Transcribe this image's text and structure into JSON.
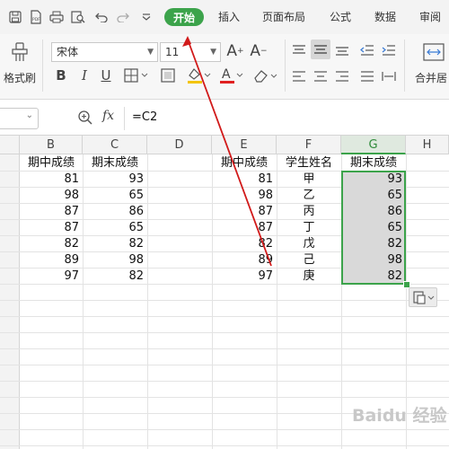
{
  "toolbar_tabs": {
    "home": "开始",
    "insert": "插入",
    "page_layout": "页面布局",
    "formulas": "公式",
    "data": "数据",
    "review": "审阅"
  },
  "ribbon": {
    "format_painter_label": "格式刷",
    "font_name": "宋体",
    "font_size": "11",
    "bold": "B",
    "italic": "I",
    "underline": "U",
    "grow_font": "A⁺",
    "shrink_font": "A⁻",
    "merge_label": "合并居"
  },
  "formula_bar": {
    "fx_label": "fx",
    "formula": "=C2"
  },
  "columns": [
    "B",
    "C",
    "D",
    "E",
    "F",
    "G",
    "H"
  ],
  "selected_column": "G",
  "left_table": {
    "headers": [
      "期中成绩",
      "期末成绩"
    ],
    "rows": [
      [
        "81",
        "93"
      ],
      [
        "98",
        "65"
      ],
      [
        "87",
        "86"
      ],
      [
        "87",
        "65"
      ],
      [
        "82",
        "82"
      ],
      [
        "89",
        "98"
      ],
      [
        "97",
        "82"
      ]
    ]
  },
  "right_table": {
    "headers": [
      "期中成绩",
      "学生姓名",
      "期末成绩"
    ],
    "rows": [
      [
        "81",
        "甲",
        "93"
      ],
      [
        "98",
        "乙",
        "65"
      ],
      [
        "87",
        "丙",
        "86"
      ],
      [
        "87",
        "丁",
        "65"
      ],
      [
        "82",
        "戊",
        "82"
      ],
      [
        "89",
        "己",
        "98"
      ],
      [
        "97",
        "庚",
        "82"
      ]
    ]
  },
  "colors": {
    "accent_green": "#3ca34b",
    "arrow_red": "#d11a1a",
    "selection_fill": "#d9d9d9"
  },
  "icons": [
    "save-icon",
    "pdf-icon",
    "print-icon",
    "print-preview-icon",
    "undo-icon",
    "redo-icon",
    "more-icon",
    "format-painter-icon",
    "paste-options-icon",
    "zoom-icon"
  ],
  "watermark": "Baidu 经验"
}
